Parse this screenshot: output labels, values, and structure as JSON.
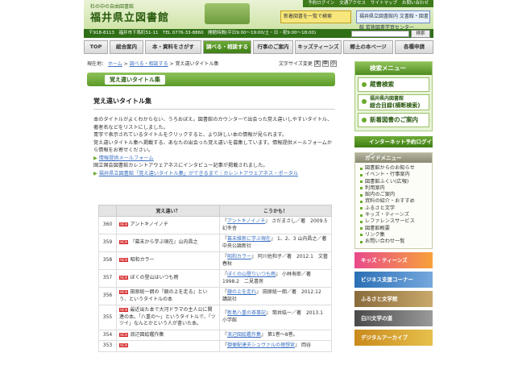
{
  "header": {
    "logo_sub": "杜の中の自由図書館",
    "logo": "福井県立図書館",
    "banner1": "新着図書を一覧で検索",
    "banner2": "福井県立図書館内 文書館・図書館 若狭図書学習センター"
  },
  "toplinks": [
    "予約ログイン",
    "交通アクセス",
    "サイトマップ",
    "お問い合わせ"
  ],
  "infobar": "〒918-8113　福井市下馬町51-11　TEL 0776-33-8860　開館時間(平日9:00〜19:00/土・日・祝9:00〜18:00)",
  "search_button": "検索",
  "nav": [
    "TOP",
    "総合案内",
    "本・資料をさがす",
    "調べる・相談する",
    "行事のご案内",
    "キッズティーンズ",
    "郷土の本ページ",
    "各種申請"
  ],
  "breadcrumb": {
    "label": "現在地：",
    "items": [
      "ホーム",
      "調べる・相談する"
    ],
    "current": "覚え違いタイトル集"
  },
  "font_size": {
    "label": "文字サイズ変更",
    "large": "大",
    "mid": "中",
    "small": "小"
  },
  "page_title": "覚え違いタイトル集",
  "content": {
    "heading": "覚え違いタイトル集",
    "para1": "本のタイトルがよくわからない、うろおぼえ。図書館のカウンターで出会った覚え違いしやすいタイトル、著者名などをリストにしました。",
    "para2": "青字で表示されているタイトルをクリックすると、より詳しい本の情報が見られます。",
    "para3": "覚え違いタイトル集へ掲載する、あなたの出会った覚え違いを募集しています。情報提供メールフォームから情報をお寄せください。",
    "link1": "情報提供メールフォーム",
    "para4": "国立国会図書館カレントアウェアネスにインタビュー記事が掲載されました。",
    "link2": "福井県立図書館「覚え違いタイトル集」ができるまで｜カレントアウェアネス・ポータル"
  },
  "table": {
    "col_wrong": "覚え違い？",
    "col_right": "こうかも！",
    "new_badge": "NEW",
    "rows": [
      {
        "num": "360",
        "wrong": "アントキノイノチ",
        "right_link": "アントキノイノチ",
        "right_rest": " さだまさし／著　2009.5　幻冬舎"
      },
      {
        "num": "359",
        "wrong": "『幕末から学ぶ現在』山内昌之",
        "right_link": "幕末維新に学ぶ現在",
        "right_rest": " 1、2、3 山内昌之／著　中央公論新社"
      },
      {
        "num": "358",
        "wrong": "昭和カラー",
        "right_link": "昭和カラー",
        "right_rest": " 阿川佐和子／著　2012.1　文藝春秋"
      },
      {
        "num": "357",
        "wrong": "ぼくの登山はいつも雨",
        "right_link": "ぼくの山登りいつも雨",
        "right_rest": " 小林寿郎／著　1998.2　二見書房"
      },
      {
        "num": "356",
        "wrong": "田原総一朗の『銀の上を走る』という、というタイトルの本",
        "right_link": "銀の上を走れ",
        "right_rest": " 田原総一朗／著　2012.12　講談社"
      },
      {
        "num": "355",
        "wrong": "最近出た本で大河ドラマの主人公に関連の本。「八重の〜」というタイトルで、「ツツイ」なんとかという人が書いた本。",
        "right_link": "新島八重の茶事記",
        "right_rest": " 筒井紘一／著　2013.1　小学館"
      },
      {
        "num": "354",
        "wrong": "浪辺図絵鑑作集",
        "right_link": "浪辺図絵鑑作集",
        "right_rest": " 第1巻〜8巻。"
      },
      {
        "num": "353",
        "wrong": "",
        "right_link": "御便配達夫シュヴァルの理想宮",
        "right_rest": " 岡谷"
      }
    ]
  },
  "side": {
    "search_menu": "検索メニュー",
    "btn1": "蔵書検索",
    "btn2a": "福井県内図書館",
    "btn2b": "総合目録(横断検索)",
    "btn3": "新着図書のご案内",
    "net": "インターネット予約ログイン",
    "guide_title": "ガイドメニュー",
    "guide": [
      "図書館からのお知らせ",
      "イベント・行事案内",
      "図書館ふくい(広報)",
      "利用案内",
      "館内のご案内",
      "資料の紹介・おすすめ",
      "ふるさと文学",
      "キッズ・ティーンズ",
      "レファレンスサービス",
      "図書館概要",
      "リンク集",
      "お問い合わせ一覧"
    ],
    "banners": [
      "キッズ・ティーンズ",
      "ビジネス支援コーナー",
      "ふるさと文学館",
      "白川文学の道",
      "デジタルアーカイブ"
    ]
  },
  "colors": {
    "green": "#3d7d14",
    "link": "#3a6fc2"
  }
}
